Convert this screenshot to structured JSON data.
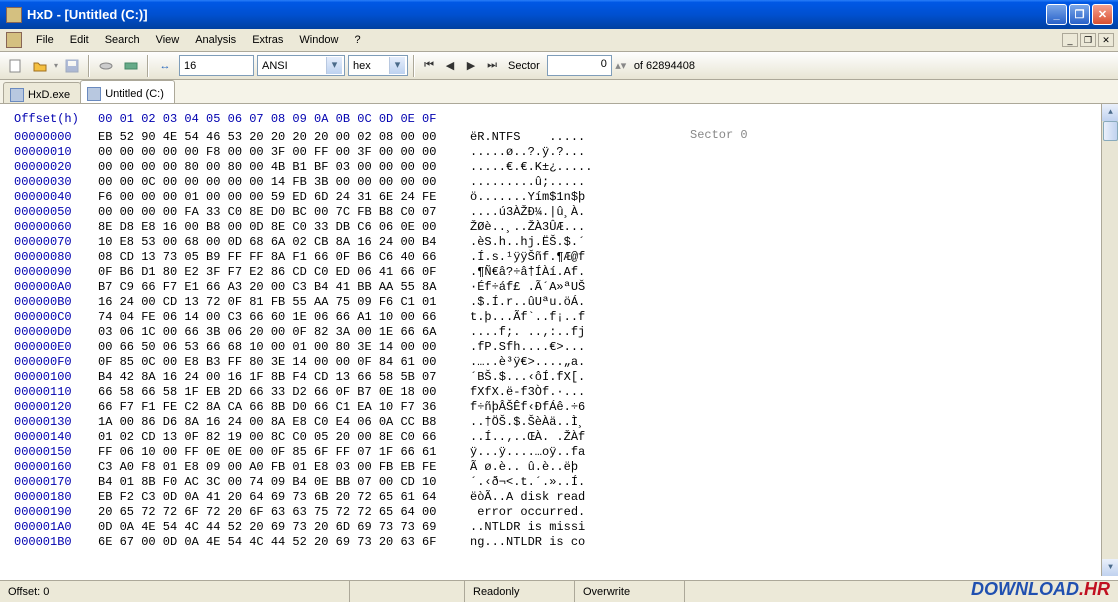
{
  "title": "HxD - [Untitled (C:)]",
  "menu": {
    "file": "File",
    "edit": "Edit",
    "search": "Search",
    "view": "View",
    "analysis": "Analysis",
    "extras": "Extras",
    "window": "Window",
    "help": "?"
  },
  "toolbar": {
    "bytes_per_row": "16",
    "charset": "ANSI",
    "offset_base": "hex",
    "sector_label": "Sector",
    "sector_value": "0",
    "of_label": "of 62894408"
  },
  "tabs": [
    {
      "label": "HxD.exe",
      "active": false
    },
    {
      "label": "Untitled (C:)",
      "active": true
    }
  ],
  "hex": {
    "offset_header": "Offset(h)",
    "col_header": "00 01 02 03 04 05 06 07 08 09 0A 0B 0C 0D 0E 0F",
    "annotation": "Sector 0",
    "rows": [
      {
        "off": "00000000",
        "b": "EB 52 90 4E 54 46 53 20 20 20 20 00 02 08 00 00",
        "a": "ëR.NTFS    ....."
      },
      {
        "off": "00000010",
        "b": "00 00 00 00 00 F8 00 00 3F 00 FF 00 3F 00 00 00",
        "a": ".....ø..?.ÿ.?..."
      },
      {
        "off": "00000020",
        "b": "00 00 00 00 80 00 80 00 4B B1 BF 03 00 00 00 00",
        "a": ".....€.€.K±¿....."
      },
      {
        "off": "00000030",
        "b": "00 00 0C 00 00 00 00 00 14 FB 3B 00 00 00 00 00",
        "a": ".........û;....."
      },
      {
        "off": "00000040",
        "b": "F6 00 00 00 01 00 00 00 59 ED 6D 24 31 6E 24 FE",
        "a": "ö.......Yím$1n$þ"
      },
      {
        "off": "00000050",
        "b": "00 00 00 00 FA 33 C0 8E D0 BC 00 7C FB B8 C0 07",
        "a": "....ú3ÀŽÐ¼.|û¸À."
      },
      {
        "off": "00000060",
        "b": "8E D8 E8 16 00 B8 00 0D 8E C0 33 DB C6 06 0E 00",
        "a": "ŽØè..¸..ŽÀ3ÛÆ..."
      },
      {
        "off": "00000070",
        "b": "10 E8 53 00 68 00 0D 68 6A 02 CB 8A 16 24 00 B4",
        "a": ".èS.h..hj.ËŠ.$.´"
      },
      {
        "off": "00000080",
        "b": "08 CD 13 73 05 B9 FF FF 8A F1 66 0F B6 C6 40 66",
        "a": ".Í.s.¹ÿÿŠñf.¶Æ@f"
      },
      {
        "off": "00000090",
        "b": "0F B6 D1 80 E2 3F F7 E2 86 CD C0 ED 06 41 66 0F",
        "a": ".¶Ñ€â?÷â†ÍÀí.Af."
      },
      {
        "off": "000000A0",
        "b": "B7 C9 66 F7 E1 66 A3 20 00 C3 B4 41 BB AA 55 8A",
        "a": "·Éf÷áf£ .Ã´A»ªUŠ"
      },
      {
        "off": "000000B0",
        "b": "16 24 00 CD 13 72 0F 81 FB 55 AA 75 09 F6 C1 01",
        "a": ".$.Í.r..ûUªu.öÁ."
      },
      {
        "off": "000000C0",
        "b": "74 04 FE 06 14 00 C3 66 60 1E 06 66 A1 10 00 66",
        "a": "t.þ...Ãf`..f¡..f"
      },
      {
        "off": "000000D0",
        "b": "03 06 1C 00 66 3B 06 20 00 0F 82 3A 00 1E 66 6A",
        "a": "....f;. ..‚:..fj"
      },
      {
        "off": "000000E0",
        "b": "00 66 50 06 53 66 68 10 00 01 00 80 3E 14 00 00",
        "a": ".fP.Sfh....€>..."
      },
      {
        "off": "000000F0",
        "b": "0F 85 0C 00 E8 B3 FF 80 3E 14 00 00 0F 84 61 00",
        "a": ".…..è³ÿ€>....„a."
      },
      {
        "off": "00000100",
        "b": "B4 42 8A 16 24 00 16 1F 8B F4 CD 13 66 58 5B 07",
        "a": "´BŠ.$...‹ôÍ.fX[."
      },
      {
        "off": "00000110",
        "b": "66 58 66 58 1F EB 2D 66 33 D2 66 0F B7 0E 18 00",
        "a": "fXfX.ë-f3Òf.·..."
      },
      {
        "off": "00000120",
        "b": "66 F7 F1 FE C2 8A CA 66 8B D0 66 C1 EA 10 F7 36",
        "a": "f÷ñþÂŠÊf‹ÐfÁê.÷6"
      },
      {
        "off": "00000130",
        "b": "1A 00 86 D6 8A 16 24 00 8A E8 C0 E4 06 0A CC B8",
        "a": "..†ÖŠ.$.ŠèÀä..Ì¸"
      },
      {
        "off": "00000140",
        "b": "01 02 CD 13 0F 82 19 00 8C C0 05 20 00 8E C0 66",
        "a": "..Í..‚..ŒÀ. .ŽÀf"
      },
      {
        "off": "00000150",
        "b": "FF 06 10 00 FF 0E 0E 00 0F 85 6F FF 07 1F 66 61",
        "a": "ÿ...ÿ....…oÿ..fa"
      },
      {
        "off": "00000160",
        "b": "C3 A0 F8 01 E8 09 00 A0 FB 01 E8 03 00 FB EB FE",
        "a": "Ã ø.è.. û.è..ëþ"
      },
      {
        "off": "00000170",
        "b": "B4 01 8B F0 AC 3C 00 74 09 B4 0E BB 07 00 CD 10",
        "a": "´.‹ð¬<.t.´.»..Í."
      },
      {
        "off": "00000180",
        "b": "EB F2 C3 0D 0A 41 20 64 69 73 6B 20 72 65 61 64",
        "a": "ëòÃ..A disk read"
      },
      {
        "off": "00000190",
        "b": "20 65 72 72 6F 72 20 6F 63 63 75 72 72 65 64 00",
        "a": " error occurred."
      },
      {
        "off": "000001A0",
        "b": "0D 0A 4E 54 4C 44 52 20 69 73 20 6D 69 73 73 69",
        "a": "..NTLDR is missi"
      },
      {
        "off": "000001B0",
        "b": "6E 67 00 0D 0A 4E 54 4C 44 52 20 69 73 20 63 6F",
        "a": "ng...NTLDR is co"
      }
    ]
  },
  "status": {
    "offset": "Offset: 0",
    "readonly": "Readonly",
    "overwrite": "Overwrite"
  },
  "watermark": {
    "p1": "DOWNLOAD",
    "p2": ".HR"
  }
}
